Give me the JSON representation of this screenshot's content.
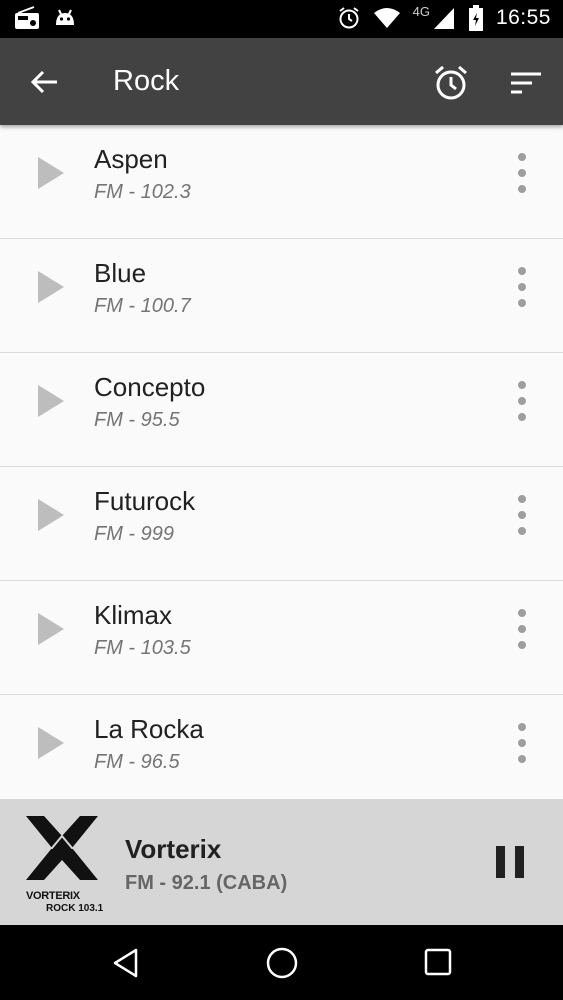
{
  "status_bar": {
    "time": "16:55",
    "network": "4G",
    "icons": [
      "radio-icon",
      "android-icon",
      "alarm-icon",
      "wifi-icon",
      "signal-icon",
      "battery-icon"
    ]
  },
  "app_bar": {
    "title": "Rock",
    "icons": [
      "back-arrow-icon",
      "alarm-icon",
      "sort-icon"
    ]
  },
  "stations": [
    {
      "name": "Aspen",
      "freq": "FM - 102.3"
    },
    {
      "name": "Blue",
      "freq": "FM - 100.7"
    },
    {
      "name": "Concepto",
      "freq": "FM - 95.5"
    },
    {
      "name": "Futurock",
      "freq": "FM - 999"
    },
    {
      "name": "Klimax",
      "freq": "FM - 103.5"
    },
    {
      "name": "La Rocka",
      "freq": "FM - 96.5"
    }
  ],
  "now_playing": {
    "name": "Vorterix",
    "freq": "FM - 92.1 (CABA)",
    "logo_line1": "VORTERIX",
    "logo_line2": "ROCK 103.1"
  },
  "colors": {
    "app_bar": "#424242",
    "status_bar": "#000000",
    "list_bg": "#fafafa",
    "player_bg": "#d6d6d6"
  }
}
